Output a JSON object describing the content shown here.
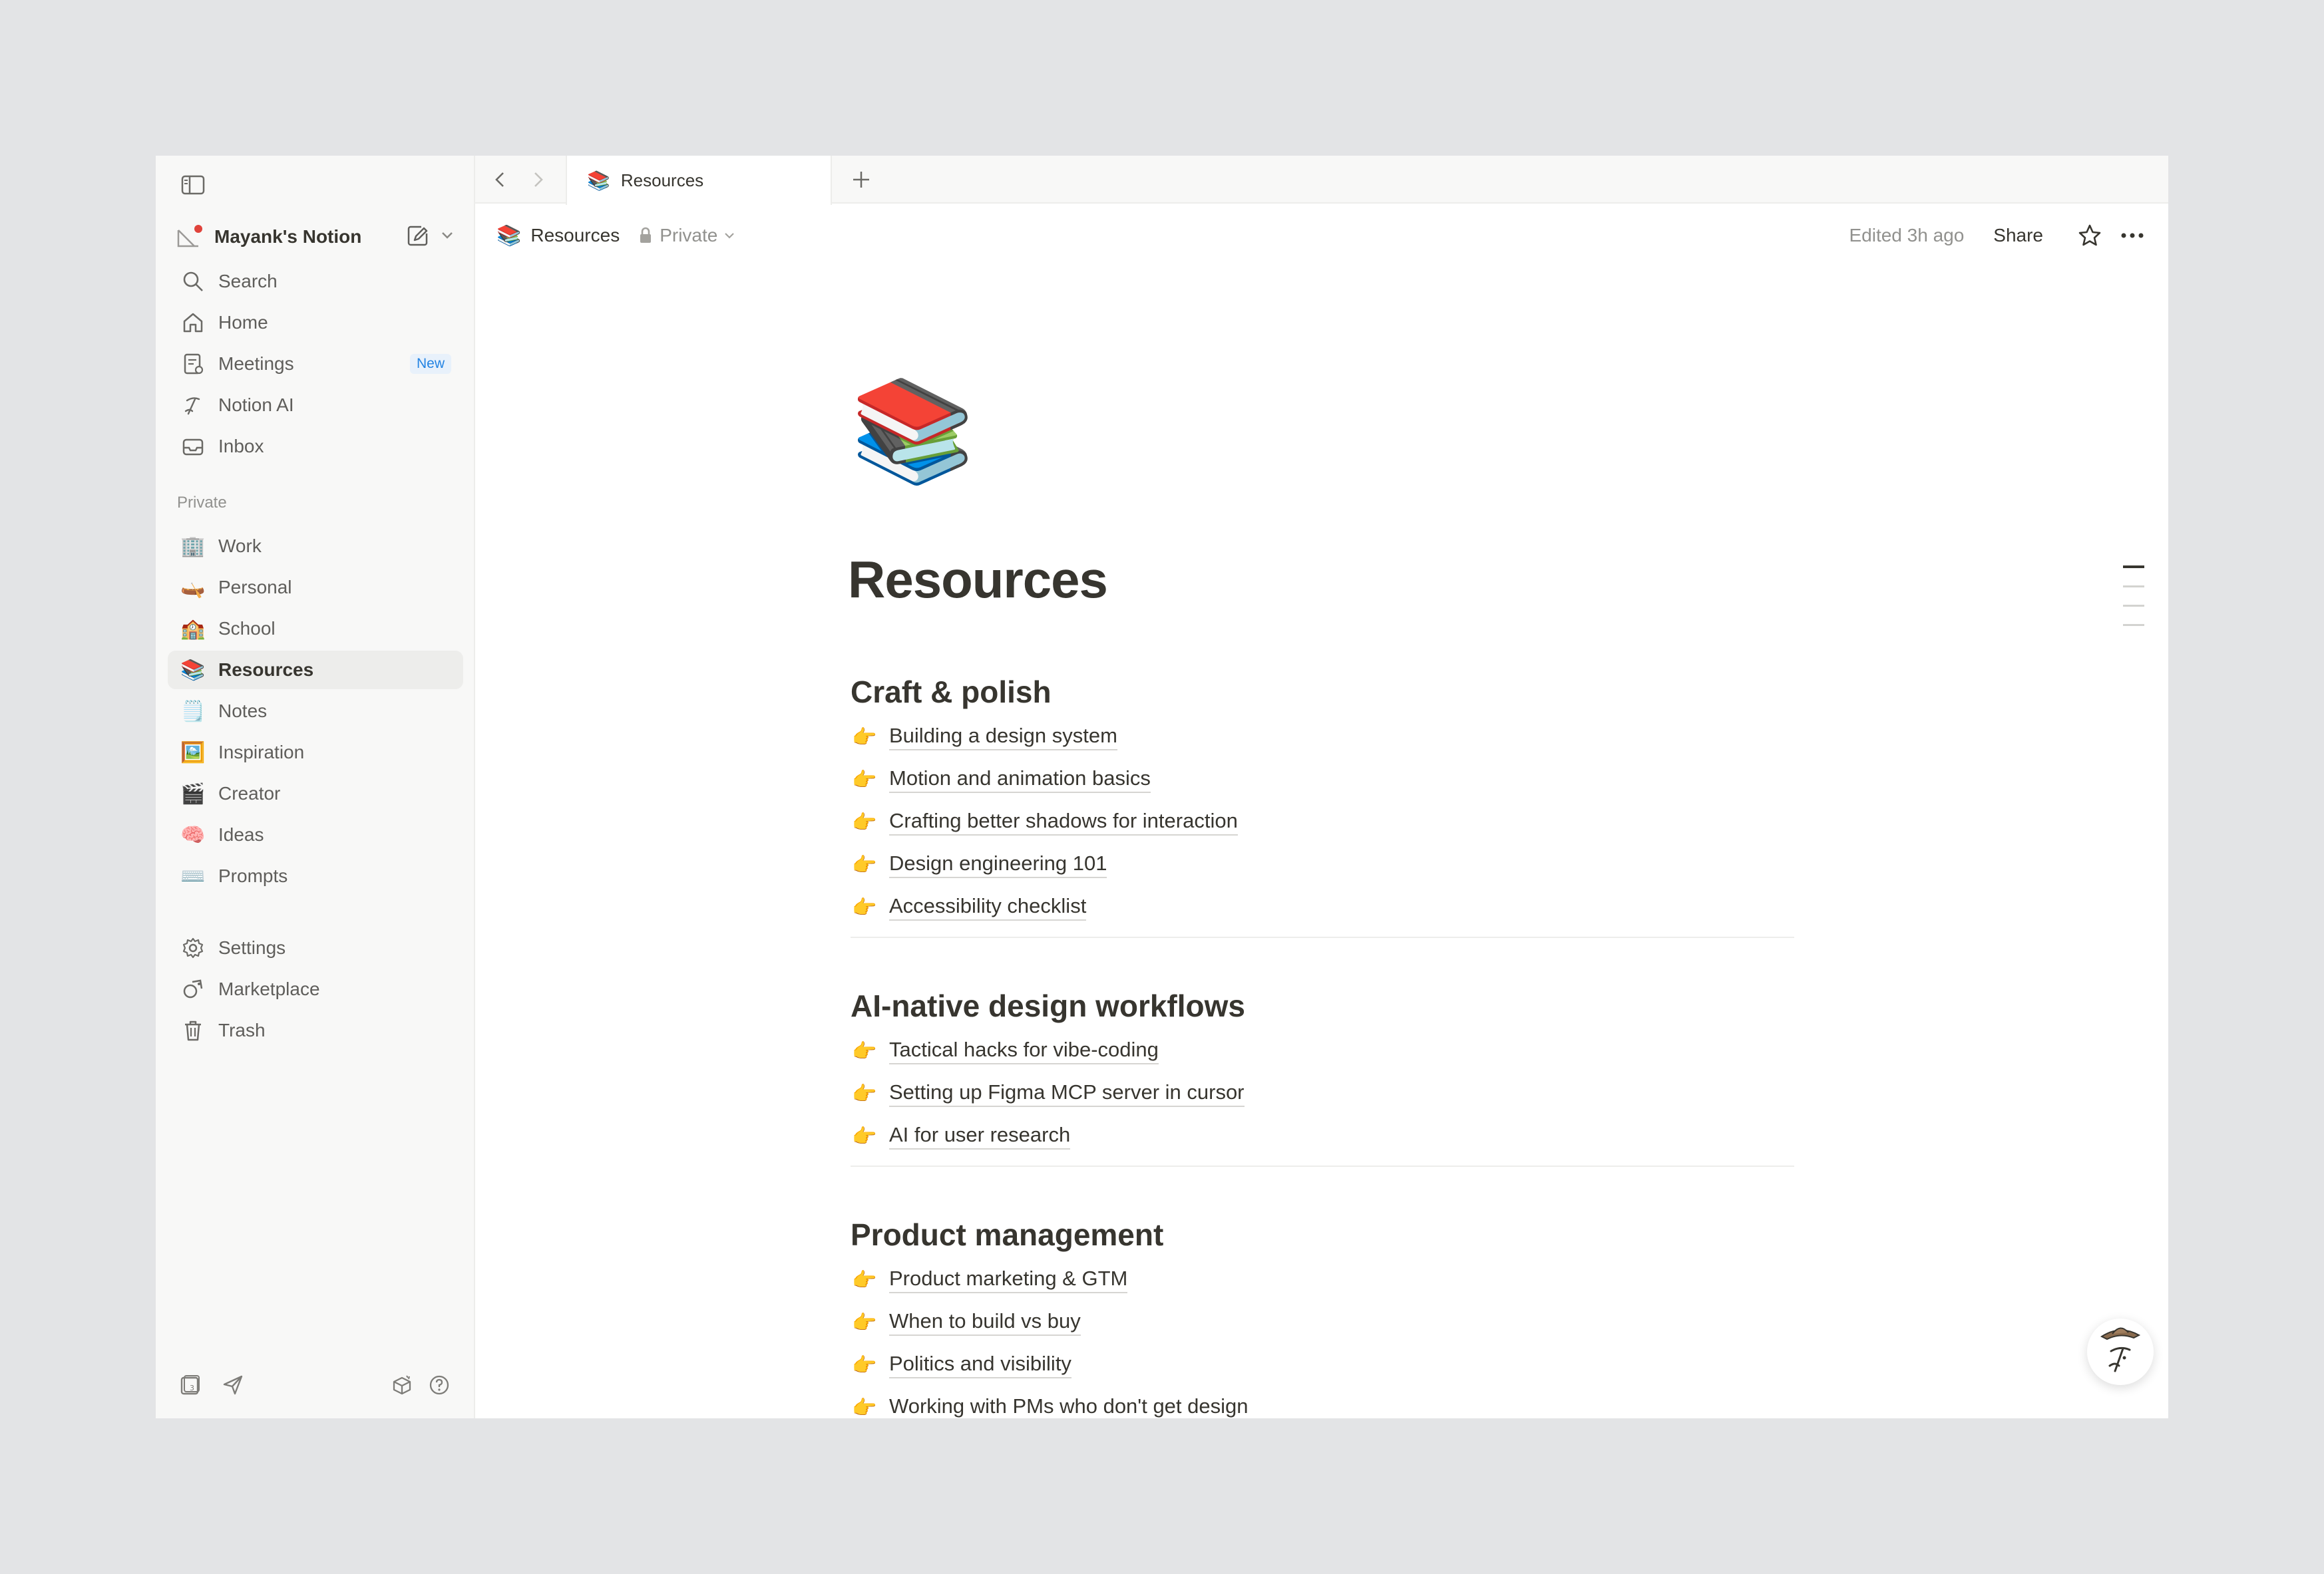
{
  "tab": {
    "emoji": "📚",
    "title": "Resources"
  },
  "workspace": {
    "name": "Mayank's Notion"
  },
  "nav": [
    {
      "label": "Search",
      "icon": "search-icon"
    },
    {
      "label": "Home",
      "icon": "home-icon"
    },
    {
      "label": "Meetings",
      "icon": "meetings-icon",
      "badge": "New"
    },
    {
      "label": "Notion AI",
      "icon": "notion-ai-icon"
    },
    {
      "label": "Inbox",
      "icon": "inbox-icon"
    }
  ],
  "private_label": "Private",
  "pages": [
    {
      "emoji": "🏢",
      "label": "Work"
    },
    {
      "emoji": "🛶",
      "label": "Personal"
    },
    {
      "emoji": "🏫",
      "label": "School"
    },
    {
      "emoji": "📚",
      "label": "Resources",
      "active": true
    },
    {
      "emoji": "🗒️",
      "label": "Notes"
    },
    {
      "emoji": "🖼️",
      "label": "Inspiration"
    },
    {
      "emoji": "🎬",
      "label": "Creator"
    },
    {
      "emoji": "🧠",
      "label": "Ideas"
    },
    {
      "emoji": "⌨️",
      "label": "Prompts"
    }
  ],
  "utility": [
    {
      "label": "Settings",
      "icon": "gear-icon"
    },
    {
      "label": "Marketplace",
      "icon": "marketplace-icon"
    },
    {
      "label": "Trash",
      "icon": "trash-icon"
    }
  ],
  "breadcrumb": {
    "emoji": "📚",
    "title": "Resources",
    "privacy": "Private"
  },
  "topbar": {
    "edited": "Edited 3h ago",
    "share": "Share"
  },
  "page": {
    "icon": "📚",
    "title": "Resources",
    "pointer": "👉",
    "sections": [
      {
        "heading": "Craft & polish",
        "links": [
          "Building a design system",
          "Motion and animation basics",
          "Crafting better shadows for interaction",
          "Design engineering 101",
          "Accessibility checklist"
        ]
      },
      {
        "heading": "AI-native design workflows",
        "links": [
          "Tactical hacks for vibe-coding",
          "Setting up Figma MCP server in cursor",
          "AI for user research"
        ]
      },
      {
        "heading": "Product management",
        "links": [
          "Product marketing & GTM",
          "When to build vs buy",
          "Politics and visibility",
          "Working with PMs who don't get design"
        ]
      }
    ]
  },
  "colors": {
    "sidebar_bg": "#f8f8f7",
    "text": "#37352f",
    "muted": "#91918e",
    "badge_blue": "#2383e2",
    "canvas": "#e3e4e6"
  }
}
